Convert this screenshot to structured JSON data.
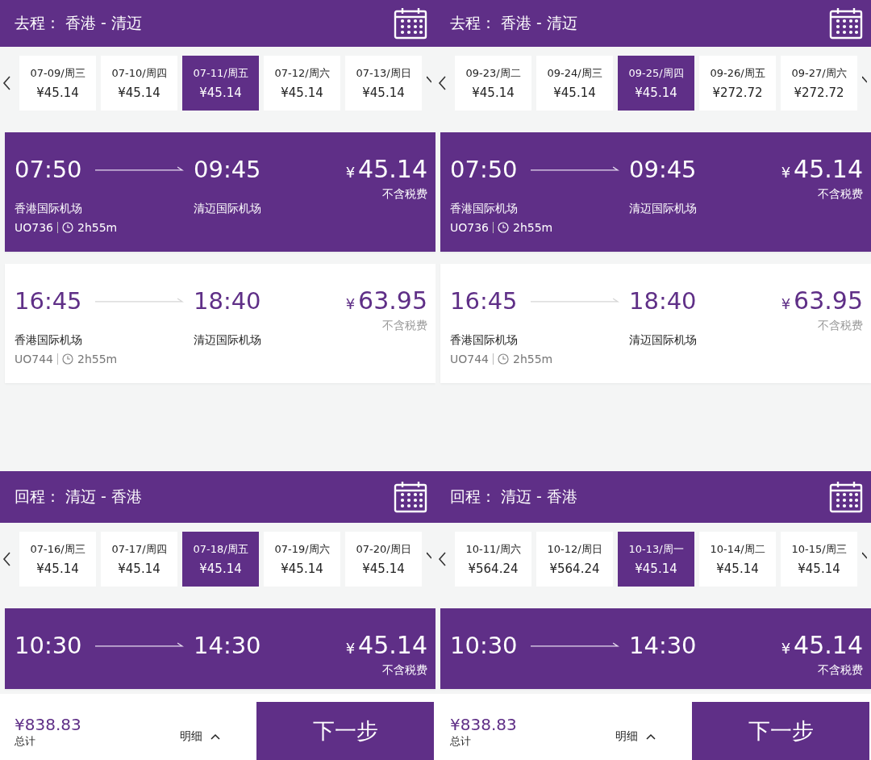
{
  "panels": [
    {
      "header": {
        "label": "去程：",
        "route": "香港 - 清迈"
      },
      "dates": [
        {
          "date": "07-09/周三",
          "price": "¥45.14",
          "selected": false
        },
        {
          "date": "07-10/周四",
          "price": "¥45.14",
          "selected": false
        },
        {
          "date": "07-11/周五",
          "price": "¥45.14",
          "selected": true
        },
        {
          "date": "07-12/周六",
          "price": "¥45.14",
          "selected": false
        },
        {
          "date": "07-13/周日",
          "price": "¥45.14",
          "selected": false
        }
      ],
      "flights": [
        {
          "selected": true,
          "depart": "07:50",
          "arrive": "09:45",
          "currency": "¥",
          "price": "45.14",
          "tax_note": "不含税费",
          "from": "香港国际机场",
          "to": "清迈国际机场",
          "flight_no": "UO736",
          "duration": "2h55m"
        },
        {
          "selected": false,
          "depart": "16:45",
          "arrive": "18:40",
          "currency": "¥",
          "price": "63.95",
          "tax_note": "不含税费",
          "from": "香港国际机场",
          "to": "清迈国际机场",
          "flight_no": "UO744",
          "duration": "2h55m"
        }
      ]
    },
    {
      "header": {
        "label": "去程：",
        "route": "香港 - 清迈"
      },
      "dates": [
        {
          "date": "09-23/周二",
          "price": "¥45.14",
          "selected": false
        },
        {
          "date": "09-24/周三",
          "price": "¥45.14",
          "selected": false
        },
        {
          "date": "09-25/周四",
          "price": "¥45.14",
          "selected": true
        },
        {
          "date": "09-26/周五",
          "price": "¥272.72",
          "selected": false
        },
        {
          "date": "09-27/周六",
          "price": "¥272.72",
          "selected": false
        }
      ],
      "flights": [
        {
          "selected": true,
          "depart": "07:50",
          "arrive": "09:45",
          "currency": "¥",
          "price": "45.14",
          "tax_note": "不含税费",
          "from": "香港国际机场",
          "to": "清迈国际机场",
          "flight_no": "UO736",
          "duration": "2h55m"
        },
        {
          "selected": false,
          "depart": "16:45",
          "arrive": "18:40",
          "currency": "¥",
          "price": "63.95",
          "tax_note": "不含税费",
          "from": "香港国际机场",
          "to": "清迈国际机场",
          "flight_no": "UO744",
          "duration": "2h55m"
        }
      ]
    },
    {
      "header": {
        "label": "回程：",
        "route": "清迈 - 香港"
      },
      "dates": [
        {
          "date": "07-16/周三",
          "price": "¥45.14",
          "selected": false
        },
        {
          "date": "07-17/周四",
          "price": "¥45.14",
          "selected": false
        },
        {
          "date": "07-18/周五",
          "price": "¥45.14",
          "selected": true
        },
        {
          "date": "07-19/周六",
          "price": "¥45.14",
          "selected": false
        },
        {
          "date": "07-20/周日",
          "price": "¥45.14",
          "selected": false
        }
      ],
      "flights": [
        {
          "selected": true,
          "depart": "10:30",
          "arrive": "14:30",
          "currency": "¥",
          "price": "45.14",
          "tax_note": "不含税费"
        }
      ],
      "footer": {
        "total": "¥838.83",
        "total_label": "总计",
        "details": "明细",
        "next": "下一步"
      }
    },
    {
      "header": {
        "label": "回程：",
        "route": "清迈 - 香港"
      },
      "dates": [
        {
          "date": "10-11/周六",
          "price": "¥564.24",
          "selected": false
        },
        {
          "date": "10-12/周日",
          "price": "¥564.24",
          "selected": false
        },
        {
          "date": "10-13/周一",
          "price": "¥45.14",
          "selected": true
        },
        {
          "date": "10-14/周二",
          "price": "¥45.14",
          "selected": false
        },
        {
          "date": "10-15/周三",
          "price": "¥45.14",
          "selected": false
        }
      ],
      "flights": [
        {
          "selected": true,
          "depart": "10:30",
          "arrive": "14:30",
          "currency": "¥",
          "price": "45.14",
          "tax_note": "不含税费"
        }
      ],
      "footer": {
        "total": "¥838.83",
        "total_label": "总计",
        "details": "明细",
        "next": "下一步"
      }
    }
  ]
}
